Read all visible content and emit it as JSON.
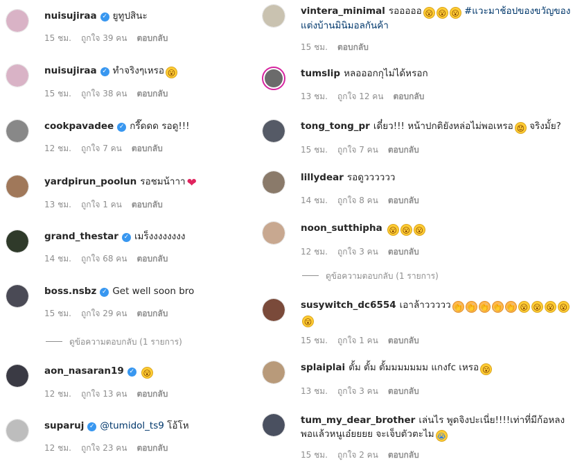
{
  "left_comments": [
    {
      "user": "nuisujiraa",
      "verified": true,
      "text": "ยูทูปสินะ",
      "emoji": [],
      "time": "15 ชม.",
      "likes": "ถูกใจ 39 คน",
      "reply": "ตอบกลับ",
      "avatar_color": "#d9b3c6"
    },
    {
      "user": "nuisujiraa",
      "verified": true,
      "text": "ทำจริงๆเหรอ",
      "emoji": [
        "face"
      ],
      "time": "15 ชม.",
      "likes": "ถูกใจ 38 คน",
      "reply": "ตอบกลับ",
      "avatar_color": "#d9b3c6"
    },
    {
      "user": "cookpavadee",
      "verified": true,
      "text": "กรี๊ดดด รอดู!!!",
      "emoji": [],
      "time": "12 ชม.",
      "likes": "ถูกใจ 7 คน",
      "reply": "ตอบกลับ",
      "avatar_color": "#888888"
    },
    {
      "user": "yardpirun_poolun",
      "verified": false,
      "text": "รอชมน้าาา",
      "emoji": [
        "heart"
      ],
      "time": "13 ชม.",
      "likes": "ถูกใจ 1 คน",
      "reply": "ตอบกลับ",
      "avatar_color": "#a0785a"
    },
    {
      "user": "grand_thestar",
      "verified": true,
      "text": "เมร็งงงงงงงง",
      "emoji": [],
      "time": "14 ชม.",
      "likes": "ถูกใจ 68 คน",
      "reply": "ตอบกลับ",
      "avatar_color": "#2f3a2a"
    },
    {
      "user": "boss.nsbz",
      "verified": true,
      "text": "Get well soon bro",
      "emoji": [],
      "time": "15 ชม.",
      "likes": "ถูกใจ 29 คน",
      "reply": "ตอบกลับ",
      "avatar_color": "#4a4a55"
    },
    {
      "user": "aon_nasaran19",
      "verified": true,
      "text": "",
      "emoji": [
        "face"
      ],
      "time": "12 ชม.",
      "likes": "ถูกใจ 13 คน",
      "reply": "ตอบกลับ",
      "avatar_color": "#3a3a44"
    },
    {
      "user": "suparuj",
      "verified": true,
      "mention": "@tumidol_ts9",
      "text": "โอ้โห",
      "emoji": [],
      "time": "12 ชม.",
      "likes": "ถูกใจ 23 คน",
      "reply": "ตอบกลับ",
      "avatar_color": "#bdbdbd"
    }
  ],
  "left_view_replies": "ดูข้อความตอบกลับ (1 รายการ)",
  "right_comments": [
    {
      "user": "vintera_minimal",
      "verified": false,
      "text": "รอออออ",
      "emoji": [
        "face",
        "face",
        "face"
      ],
      "hashtag": "#แวะมาช้อปของขวัญของแต่งบ้านมินิมอลกันค้า",
      "time": "15 ชม.",
      "likes": "",
      "reply": "ตอบกลับ",
      "avatar_color": "#c9c2b0"
    },
    {
      "user": "tumslip",
      "verified": false,
      "text": "หลอออกกุไม่ได้หรอก",
      "emoji": [],
      "time": "13 ชม.",
      "likes": "ถูกใจ 12 คน",
      "reply": "ตอบกลับ",
      "avatar_color": "#6b6b6b",
      "ring": true
    },
    {
      "user": "tong_tong_pr",
      "verified": false,
      "text": "เดี๋ยว!!! หน้าปกติยังหล่อไม่พอเหรอ",
      "emoji": [
        "sad"
      ],
      "text2": "จริงมั้ย?",
      "time": "15 ชม.",
      "likes": "ถูกใจ 7 คน",
      "reply": "ตอบกลับ",
      "avatar_color": "#555a66"
    },
    {
      "user": "lillydear",
      "verified": false,
      "text": "รอดูวววววว",
      "emoji": [],
      "time": "14 ชม.",
      "likes": "ถูกใจ 8 คน",
      "reply": "ตอบกลับ",
      "avatar_color": "#8a7a6a"
    },
    {
      "user": "noon_sutthipha",
      "verified": false,
      "text": "",
      "emoji": [
        "face",
        "face",
        "face"
      ],
      "time": "12 ชม.",
      "likes": "ถูกใจ 3 คน",
      "reply": "ตอบกลับ",
      "avatar_color": "#c8a890"
    },
    {
      "user": "susywitch_dc6554",
      "verified": false,
      "text": "เอาล้าววววว",
      "emoji": [
        "clap",
        "clap",
        "clap",
        "clap",
        "clap",
        "face",
        "face",
        "face",
        "face",
        "face"
      ],
      "time": "15 ชม.",
      "likes": "ถูกใจ 1 คน",
      "reply": "ตอบกลับ",
      "avatar_color": "#7a4a3a"
    },
    {
      "user": "splaiplai",
      "verified": false,
      "text": "ตั้ม ตั้ม ตั้มมมมมมม แกงfc เหรอ",
      "emoji": [
        "face"
      ],
      "time": "13 ชม.",
      "likes": "ถูกใจ 3 คน",
      "reply": "ตอบกลับ",
      "avatar_color": "#b89a7a"
    },
    {
      "user": "tum_my_dear_brother",
      "verified": false,
      "text": "เล่นไร พูดจิงปะเนี่ย!!!!เท่าที่มีก้อหลงพอแล้วหนูเอ๋ยยยย จะเจ็บตัวตะไม",
      "emoji": [
        "cry"
      ],
      "time": "15 ชม.",
      "likes": "ถูกใจ 2 คน",
      "reply": "ตอบกลับ",
      "avatar_color": "#4a5060"
    }
  ],
  "right_view_replies": "ดูข้อความตอบกลับ (1 รายการ)",
  "icons": {
    "verified": "verified-check-icon",
    "face": "astonished-face-emoji",
    "heart": "heart-emoji",
    "clap": "clap-emoji",
    "sad": "sad-face-emoji",
    "cry": "crying-face-emoji"
  }
}
